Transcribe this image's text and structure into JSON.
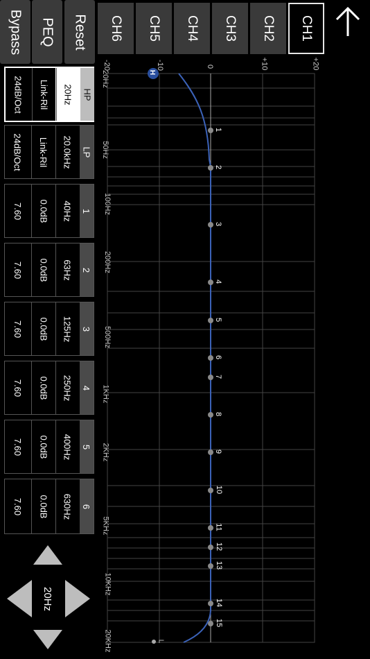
{
  "channels": [
    "CH1",
    "CH2",
    "CH3",
    "CH4",
    "CH5",
    "CH6"
  ],
  "active_channel": "CH1",
  "side_buttons": {
    "reset": "Reset",
    "peq": "PEQ",
    "bypass": "Bypass"
  },
  "gain_ticks": [
    "+20",
    "+10",
    "0",
    "-10",
    "-20"
  ],
  "freq_ticks": [
    "20Hz",
    "50Hz",
    "100Hz",
    "200Hz",
    "500Hz",
    "1KHz",
    "2KHz",
    "5KHz",
    "10KHz",
    "20KHz"
  ],
  "bands": [
    {
      "header": "HP",
      "v1": "20Hz",
      "v2": "Link-Ril",
      "v3": "24dB/Oct"
    },
    {
      "header": "LP",
      "v1": "20.0kHz",
      "v2": "Link-Ril",
      "v3": "24dB/Oct"
    },
    {
      "header": "1",
      "v1": "40Hz",
      "v2": "0.0dB",
      "v3": "7.60"
    },
    {
      "header": "2",
      "v1": "63Hz",
      "v2": "0.0dB",
      "v3": "7.60"
    },
    {
      "header": "3",
      "v1": "125Hz",
      "v2": "0.0dB",
      "v3": "7.60"
    },
    {
      "header": "4",
      "v1": "250Hz",
      "v2": "0.0dB",
      "v3": "7.60"
    },
    {
      "header": "5",
      "v1": "400Hz",
      "v2": "0.0dB",
      "v3": "7.60"
    },
    {
      "header": "6",
      "v1": "630Hz",
      "v2": "0.0dB",
      "v3": "7.60"
    }
  ],
  "eq_points": [
    "1",
    "2",
    "3",
    "4",
    "5",
    "6",
    "7",
    "8",
    "9",
    "10",
    "11",
    "12",
    "13",
    "14",
    "15"
  ],
  "markers": {
    "high": "H",
    "low": "L"
  },
  "nav_value": "20Hz",
  "colors": {
    "curve": "#3b62b8",
    "marker": "#2a4f9e",
    "point": "#8a8a8a"
  }
}
